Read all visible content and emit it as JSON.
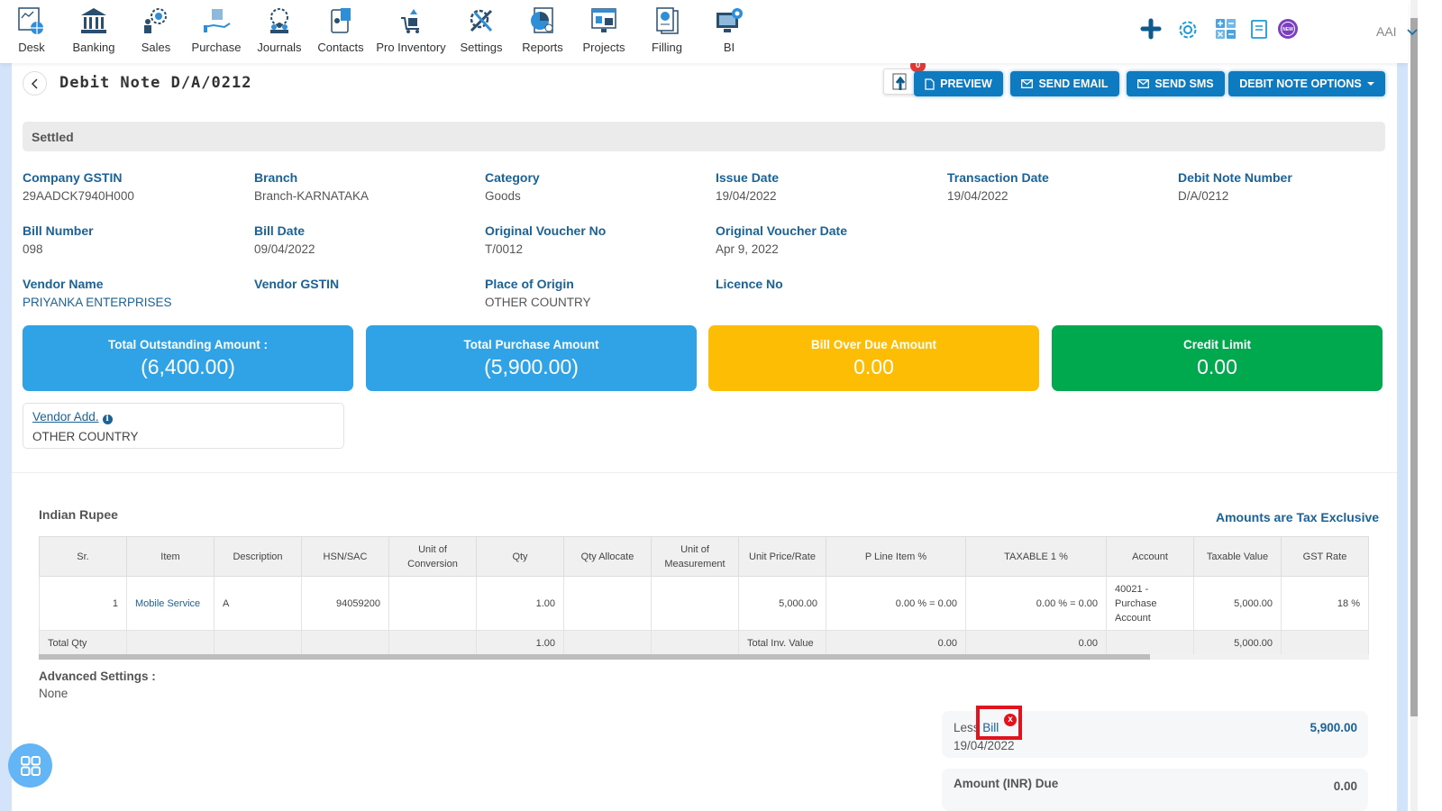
{
  "nav": {
    "items": [
      {
        "label": "Desk",
        "icon": "desk-icon"
      },
      {
        "label": "Banking",
        "icon": "bank-icon"
      },
      {
        "label": "Sales",
        "icon": "sales-icon"
      },
      {
        "label": "Purchase",
        "icon": "purchase-icon"
      },
      {
        "label": "Journals",
        "icon": "journals-icon"
      },
      {
        "label": "Contacts",
        "icon": "contacts-icon"
      },
      {
        "label": "Pro Inventory",
        "icon": "inventory-icon"
      },
      {
        "label": "Settings",
        "icon": "settings-tools-icon"
      },
      {
        "label": "Reports",
        "icon": "reports-icon"
      },
      {
        "label": "Projects",
        "icon": "projects-icon"
      },
      {
        "label": "Filling",
        "icon": "filling-icon"
      },
      {
        "label": "BI",
        "icon": "bi-icon"
      }
    ],
    "user": "AAI",
    "new_badge": "NEW"
  },
  "header": {
    "title": "Debit Note D/A/0212",
    "upload_count": "0",
    "buttons": {
      "preview": "PREVIEW",
      "send_email": "SEND EMAIL",
      "send_sms": "SEND SMS",
      "options": "DEBIT NOTE OPTIONS"
    }
  },
  "status": "Settled",
  "fields": {
    "company_gstin": {
      "label": "Company GSTIN",
      "value": "29AADCK7940H000"
    },
    "branch": {
      "label": "Branch",
      "value": "Branch-KARNATAKA"
    },
    "category": {
      "label": "Category",
      "value": "Goods"
    },
    "issue_date": {
      "label": "Issue Date",
      "value": "19/04/2022"
    },
    "transaction_date": {
      "label": "Transaction Date",
      "value": "19/04/2022"
    },
    "debit_note_number": {
      "label": "Debit Note Number",
      "value": "D/A/0212"
    },
    "bill_number": {
      "label": "Bill Number",
      "value": "098"
    },
    "bill_date": {
      "label": "Bill Date",
      "value": "09/04/2022"
    },
    "original_voucher_no": {
      "label": "Original Voucher No",
      "value": "T/0012"
    },
    "original_voucher_date": {
      "label": "Original Voucher Date",
      "value": "Apr 9, 2022"
    },
    "vendor_name": {
      "label": "Vendor Name",
      "value": "PRIYANKA ENTERPRISES"
    },
    "vendor_gstin": {
      "label": "Vendor GSTIN",
      "value": ""
    },
    "place_of_origin": {
      "label": "Place of Origin",
      "value": "OTHER COUNTRY"
    },
    "licence_no": {
      "label": "Licence No",
      "value": ""
    }
  },
  "cards": [
    {
      "title": "Total Outstanding Amount :",
      "value": "(6,400.00)",
      "color": "#2fa3e6"
    },
    {
      "title": "Total Purchase Amount",
      "value": "(5,900.00)",
      "color": "#2fa3e6"
    },
    {
      "title": "Bill Over Due Amount",
      "value": "0.00",
      "color": "#fcbd04"
    },
    {
      "title": "Credit Limit",
      "value": "0.00",
      "color": "#00a84e"
    }
  ],
  "vendor_address": {
    "label": "Vendor Add.",
    "value": "OTHER COUNTRY"
  },
  "currency": "Indian Rupee",
  "tax_mode": "Amounts are Tax Exclusive",
  "table": {
    "headers": [
      "Sr.",
      "Item",
      "Description",
      "HSN/SAC",
      "Unit of Conversion",
      "Qty",
      "Qty Allocate",
      "Unit of Measurement",
      "Unit Price/Rate",
      "P Line Item %",
      "TAXABLE 1 %",
      "Account",
      "Taxable Value",
      "GST Rate"
    ],
    "rows": [
      {
        "sr": "1",
        "item": "Mobile Service",
        "description": "A",
        "hsn": "94059200",
        "unit_conversion": "",
        "qty": "1.00",
        "qty_allocate": "",
        "uom": "",
        "unit_price": "5,000.00",
        "p_line_item": "0.00 % = 0.00",
        "taxable1": "0.00 % = 0.00",
        "account": "40021 - Purchase Account",
        "taxable_value": "5,000.00",
        "gst_rate": "18 %"
      }
    ],
    "totals": {
      "label": "Total Qty",
      "qty": "1.00",
      "inv_label": "Total Inv. Value",
      "p_line_item": "0.00",
      "taxable1": "0.00",
      "taxable_value": "5,000.00"
    }
  },
  "advanced": {
    "label": "Advanced Settings :",
    "value": "None"
  },
  "summary": {
    "less_prefix": "Less",
    "less_link": "Bill",
    "less_date": "19/04/2022",
    "less_amount": "5,900.00",
    "due_label": "Amount (INR) Due",
    "due_amount": "0.00"
  },
  "colors": {
    "primary": "#0e7ac0",
    "label": "#1b6296",
    "highlight": "#e0141e"
  }
}
